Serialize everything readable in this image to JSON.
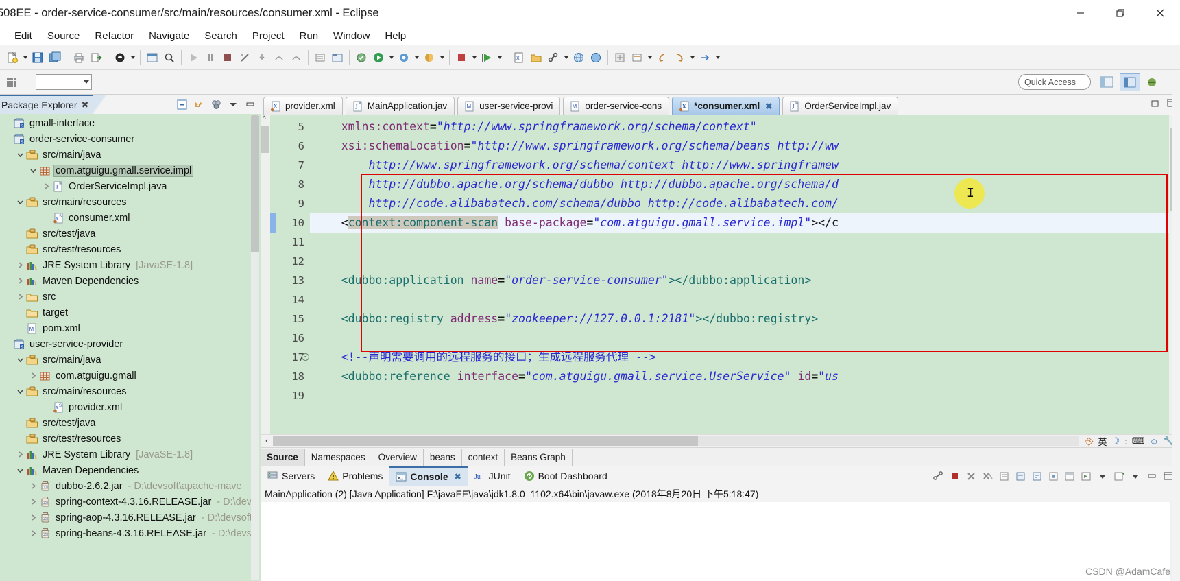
{
  "window": {
    "title": "508EE - order-service-consumer/src/main/resources/consumer.xml - Eclipse",
    "minimize_label": "minimize-icon",
    "restore_label": "restore-icon",
    "close_label": "close-icon"
  },
  "menubar": {
    "items": [
      "Edit",
      "Source",
      "Refactor",
      "Navigate",
      "Search",
      "Project",
      "Run",
      "Window",
      "Help"
    ]
  },
  "perspective_bar": {
    "quick_access_placeholder": "Quick Access"
  },
  "package_explorer": {
    "tab_label": "Package Explorer",
    "tab_close": "✖",
    "tools": [
      "collapse-all-icon",
      "link-with-editor-icon",
      "filter-icon",
      "view-menu-icon",
      "minimize-icon"
    ],
    "tree": [
      {
        "indent": 0,
        "twist": "",
        "icon": "project-icon",
        "label": "gmall-interface",
        "dim": ""
      },
      {
        "indent": 0,
        "twist": "",
        "icon": "project-icon",
        "label": "order-service-consumer",
        "dim": ""
      },
      {
        "indent": 1,
        "twist": "v",
        "icon": "source-folder-icon",
        "label": "src/main/java",
        "dim": ""
      },
      {
        "indent": 2,
        "twist": "v",
        "icon": "package-icon",
        "label": "com.atguigu.gmall.service.impl",
        "dim": "",
        "selected": true
      },
      {
        "indent": 3,
        "twist": ">",
        "icon": "java-file-icon",
        "label": "OrderServiceImpl.java",
        "dim": ""
      },
      {
        "indent": 1,
        "twist": "v",
        "icon": "source-folder-icon",
        "label": "src/main/resources",
        "dim": ""
      },
      {
        "indent": 3,
        "twist": "",
        "icon": "xml-spring-icon",
        "label": "consumer.xml",
        "dim": ""
      },
      {
        "indent": 1,
        "twist": "",
        "icon": "source-folder-icon",
        "label": "src/test/java",
        "dim": ""
      },
      {
        "indent": 1,
        "twist": "",
        "icon": "source-folder-icon",
        "label": "src/test/resources",
        "dim": ""
      },
      {
        "indent": 1,
        "twist": ">",
        "icon": "library-icon",
        "label": "JRE System Library",
        "dim": "[JavaSE-1.8]"
      },
      {
        "indent": 1,
        "twist": ">",
        "icon": "library-icon",
        "label": "Maven Dependencies",
        "dim": ""
      },
      {
        "indent": 1,
        "twist": ">",
        "icon": "folder-icon",
        "label": "src",
        "dim": ""
      },
      {
        "indent": 1,
        "twist": "",
        "icon": "folder-icon",
        "label": "target",
        "dim": ""
      },
      {
        "indent": 1,
        "twist": "",
        "icon": "pom-icon",
        "label": "pom.xml",
        "dim": ""
      },
      {
        "indent": 0,
        "twist": "",
        "icon": "project-icon",
        "label": "user-service-provider",
        "dim": ""
      },
      {
        "indent": 1,
        "twist": "v",
        "icon": "source-folder-icon",
        "label": "src/main/java",
        "dim": ""
      },
      {
        "indent": 2,
        "twist": ">",
        "icon": "package-icon",
        "label": "com.atguigu.gmall",
        "dim": ""
      },
      {
        "indent": 1,
        "twist": "v",
        "icon": "source-folder-icon",
        "label": "src/main/resources",
        "dim": ""
      },
      {
        "indent": 3,
        "twist": "",
        "icon": "xml-spring-icon",
        "label": "provider.xml",
        "dim": ""
      },
      {
        "indent": 1,
        "twist": "",
        "icon": "source-folder-icon",
        "label": "src/test/java",
        "dim": ""
      },
      {
        "indent": 1,
        "twist": "",
        "icon": "source-folder-icon",
        "label": "src/test/resources",
        "dim": ""
      },
      {
        "indent": 1,
        "twist": ">",
        "icon": "library-icon",
        "label": "JRE System Library",
        "dim": "[JavaSE-1.8]"
      },
      {
        "indent": 1,
        "twist": "v",
        "icon": "library-icon",
        "label": "Maven Dependencies",
        "dim": ""
      },
      {
        "indent": 2,
        "twist": ">",
        "icon": "jar-icon",
        "label": "dubbo-2.6.2.jar",
        "dim": "- D:\\devsoft\\apache-mave"
      },
      {
        "indent": 2,
        "twist": ">",
        "icon": "jar-icon",
        "label": "spring-context-4.3.16.RELEASE.jar",
        "dim": "- D:\\dev"
      },
      {
        "indent": 2,
        "twist": ">",
        "icon": "jar-icon",
        "label": "spring-aop-4.3.16.RELEASE.jar",
        "dim": "- D:\\devsoft"
      },
      {
        "indent": 2,
        "twist": ">",
        "icon": "jar-icon",
        "label": "spring-beans-4.3.16.RELEASE.jar",
        "dim": "- D:\\devs"
      }
    ]
  },
  "editor": {
    "tabs": [
      {
        "label": "provider.xml",
        "icon": "xml-file-icon",
        "active": false,
        "dirty": false
      },
      {
        "label": "MainApplication.jav",
        "icon": "java-file-icon",
        "active": false,
        "dirty": false
      },
      {
        "label": "user-service-provi",
        "icon": "pom-icon",
        "active": false,
        "dirty": false
      },
      {
        "label": "order-service-cons",
        "icon": "pom-icon",
        "active": false,
        "dirty": false
      },
      {
        "label": "*consumer.xml",
        "icon": "xml-file-icon",
        "active": true,
        "dirty": true,
        "close": "✖"
      },
      {
        "label": "OrderServiceImpl.jav",
        "icon": "java-file-icon",
        "active": false,
        "dirty": false
      }
    ],
    "first_line_number": 5,
    "lines": [
      {
        "num": "5",
        "fold": false,
        "tokens": [
          {
            "t": "    ",
            "c": "t-punc"
          },
          {
            "t": "xmlns:context",
            "c": "t-attr"
          },
          {
            "t": "=",
            "c": "t-eq"
          },
          {
            "t": "\"http://www.springframework.org/schema/context\"",
            "c": "t-val"
          }
        ]
      },
      {
        "num": "6",
        "fold": false,
        "tokens": [
          {
            "t": "    ",
            "c": "t-punc"
          },
          {
            "t": "xsi:schemaLocation",
            "c": "t-attr"
          },
          {
            "t": "=",
            "c": "t-eq"
          },
          {
            "t": "\"http://www.springframework.org/schema/beans http://ww",
            "c": "t-val"
          }
        ]
      },
      {
        "num": "7",
        "fold": false,
        "tokens": [
          {
            "t": "        http://www.springframework.org/schema/context http://www.springframew",
            "c": "t-val"
          }
        ]
      },
      {
        "num": "8",
        "fold": false,
        "tokens": [
          {
            "t": "        http://dubbo.apache.org/schema/dubbo http://dubbo.apache.org/schema/d",
            "c": "t-val"
          }
        ]
      },
      {
        "num": "9",
        "fold": false,
        "tokens": [
          {
            "t": "        http://code.alibabatech.com/schema/dubbo http://code.alibabatech.com/",
            "c": "t-val"
          }
        ]
      },
      {
        "num": "10",
        "fold": false,
        "current": true,
        "tokens": [
          {
            "t": "    ",
            "c": "t-punc"
          },
          {
            "t": "<",
            "c": "t-punc"
          },
          {
            "t": "context:component-scan",
            "c": "t-tag t-hl"
          },
          {
            "t": " ",
            "c": "t-punc"
          },
          {
            "t": "base-package",
            "c": "t-attr"
          },
          {
            "t": "=",
            "c": "t-eq"
          },
          {
            "t": "\"com.atguigu.gmall.service.impl\"",
            "c": "t-val"
          },
          {
            "t": "></c",
            "c": "t-punc"
          }
        ]
      },
      {
        "num": "11",
        "fold": false,
        "tokens": []
      },
      {
        "num": "12",
        "fold": false,
        "tokens": []
      },
      {
        "num": "13",
        "fold": false,
        "tokens": [
          {
            "t": "    ",
            "c": "t-punc"
          },
          {
            "t": "<dubbo:application",
            "c": "t-tag"
          },
          {
            "t": " ",
            "c": "t-punc"
          },
          {
            "t": "name",
            "c": "t-attr"
          },
          {
            "t": "=",
            "c": "t-eq"
          },
          {
            "t": "\"order-service-consumer\"",
            "c": "t-val"
          },
          {
            "t": "></dubbo:application>",
            "c": "t-tag"
          }
        ]
      },
      {
        "num": "14",
        "fold": false,
        "tokens": []
      },
      {
        "num": "15",
        "fold": false,
        "tokens": [
          {
            "t": "    ",
            "c": "t-punc"
          },
          {
            "t": "<dubbo:registry",
            "c": "t-tag"
          },
          {
            "t": " ",
            "c": "t-punc"
          },
          {
            "t": "address",
            "c": "t-attr"
          },
          {
            "t": "=",
            "c": "t-eq"
          },
          {
            "t": "\"zookeeper://127.0.0.1:2181\"",
            "c": "t-val"
          },
          {
            "t": "></dubbo:registry>",
            "c": "t-tag"
          }
        ]
      },
      {
        "num": "16",
        "fold": false,
        "tokens": []
      },
      {
        "num": "17",
        "fold": true,
        "tokens": [
          {
            "t": "    ",
            "c": "t-punc"
          },
          {
            "t": "<!--声明需要调用的远程服务的接口；生成远程服务代理 -->",
            "c": "t-comment"
          }
        ]
      },
      {
        "num": "18",
        "fold": false,
        "tokens": [
          {
            "t": "    ",
            "c": "t-punc"
          },
          {
            "t": "<dubbo:reference",
            "c": "t-tag"
          },
          {
            "t": " ",
            "c": "t-punc"
          },
          {
            "t": "interface",
            "c": "t-attr"
          },
          {
            "t": "=",
            "c": "t-eq"
          },
          {
            "t": "\"com.atguigu.gmall.service.UserService\"",
            "c": "t-val"
          },
          {
            "t": " ",
            "c": "t-punc"
          },
          {
            "t": "id",
            "c": "t-attr"
          },
          {
            "t": "=",
            "c": "t-eq"
          },
          {
            "t": "\"us",
            "c": "t-val"
          }
        ]
      },
      {
        "num": "19",
        "fold": false,
        "tokens": []
      }
    ],
    "bottom_tabs": [
      "Source",
      "Namespaces",
      "Overview",
      "beans",
      "context",
      "Beans Graph"
    ],
    "bottom_tab_active": "Source",
    "ime_tray": [
      "英",
      "☽",
      ":",
      "⌨",
      "☺",
      "🔧"
    ]
  },
  "console": {
    "tabs": [
      {
        "label": "Servers",
        "icon": "servers-icon",
        "active": false
      },
      {
        "label": "Problems",
        "icon": "problems-icon",
        "active": false
      },
      {
        "label": "Console",
        "icon": "console-icon",
        "active": true,
        "close": "✖"
      },
      {
        "label": "JUnit",
        "icon": "junit-icon",
        "active": false
      },
      {
        "label": "Boot Dashboard",
        "icon": "boot-dashboard-icon",
        "active": false
      }
    ],
    "launch_line": "MainApplication (2) [Java Application] F:\\javaEE\\java\\jdk1.8.0_1102.x64\\bin\\javaw.exe (2018年8月20日 下午5:18:47)",
    "watermark": "CSDN @AdamCafe"
  },
  "colors": {
    "tree_bg": "#cfe7d0",
    "editor_bg": "#cfe7d0",
    "accent_tab": "#3b6ea5",
    "highlight_box": "#e00000",
    "cursor_blob": "#f2e63c",
    "attr": "#7f2d75",
    "value": "#2a2ad0",
    "tag": "#1a6e6e"
  }
}
